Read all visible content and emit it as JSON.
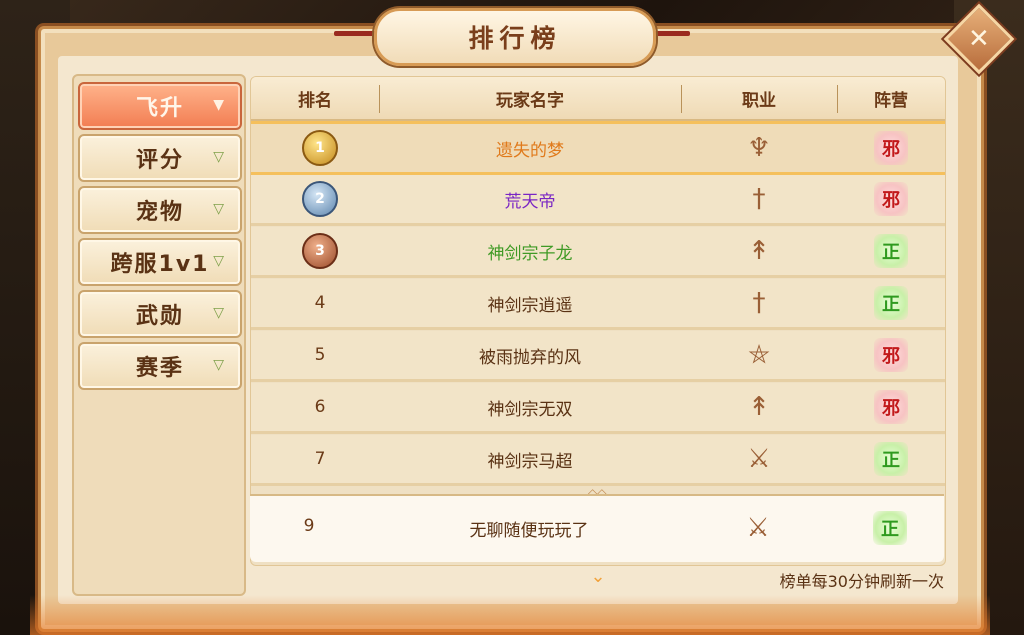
{
  "title": "排行榜",
  "close_label": "✕",
  "sidebar": {
    "items": [
      {
        "label": "飞升",
        "active": true
      },
      {
        "label": "评分",
        "active": false
      },
      {
        "label": "宠物",
        "active": false
      },
      {
        "label": "跨服1v1",
        "active": false
      },
      {
        "label": "武勋",
        "active": false
      },
      {
        "label": "赛季",
        "active": false
      }
    ]
  },
  "table": {
    "headers": {
      "rank": "排名",
      "name": "玩家名字",
      "job": "职业",
      "camp": "阵营"
    },
    "rows": [
      {
        "rank": "1",
        "name": "遗失的梦",
        "name_color": "#e07a1b",
        "job_icon": "trident-icon",
        "camp": "邪"
      },
      {
        "rank": "2",
        "name": "荒天帝",
        "name_color": "#7a26c4",
        "job_icon": "sword-icon",
        "camp": "邪"
      },
      {
        "rank": "3",
        "name": "神剑宗子龙",
        "name_color": "#3f9a25",
        "job_icon": "spear-icon",
        "camp": "正"
      },
      {
        "rank": "4",
        "name": "神剑宗逍遥",
        "name_color": "#5a3214",
        "job_icon": "sword-icon",
        "camp": "正"
      },
      {
        "rank": "5",
        "name": "被雨抛弃的风",
        "name_color": "#5a3214",
        "job_icon": "pentagram-icon",
        "camp": "邪"
      },
      {
        "rank": "6",
        "name": "神剑宗无双",
        "name_color": "#5a3214",
        "job_icon": "spear-icon",
        "camp": "邪"
      },
      {
        "rank": "7",
        "name": "神剑宗马超",
        "name_color": "#5a3214",
        "job_icon": "crossed-blades-icon",
        "camp": "正"
      }
    ],
    "self_row": {
      "rank": "9",
      "name": "无聊随便玩玩了",
      "job_icon": "crossed-blades-icon",
      "camp": "正"
    }
  },
  "refresh_note": "榜单每30分钟刷新一次",
  "colors": {
    "active_tab": "#f27d52",
    "evil_camp": "#c2191b",
    "righteous_camp": "#2f9a1f"
  }
}
